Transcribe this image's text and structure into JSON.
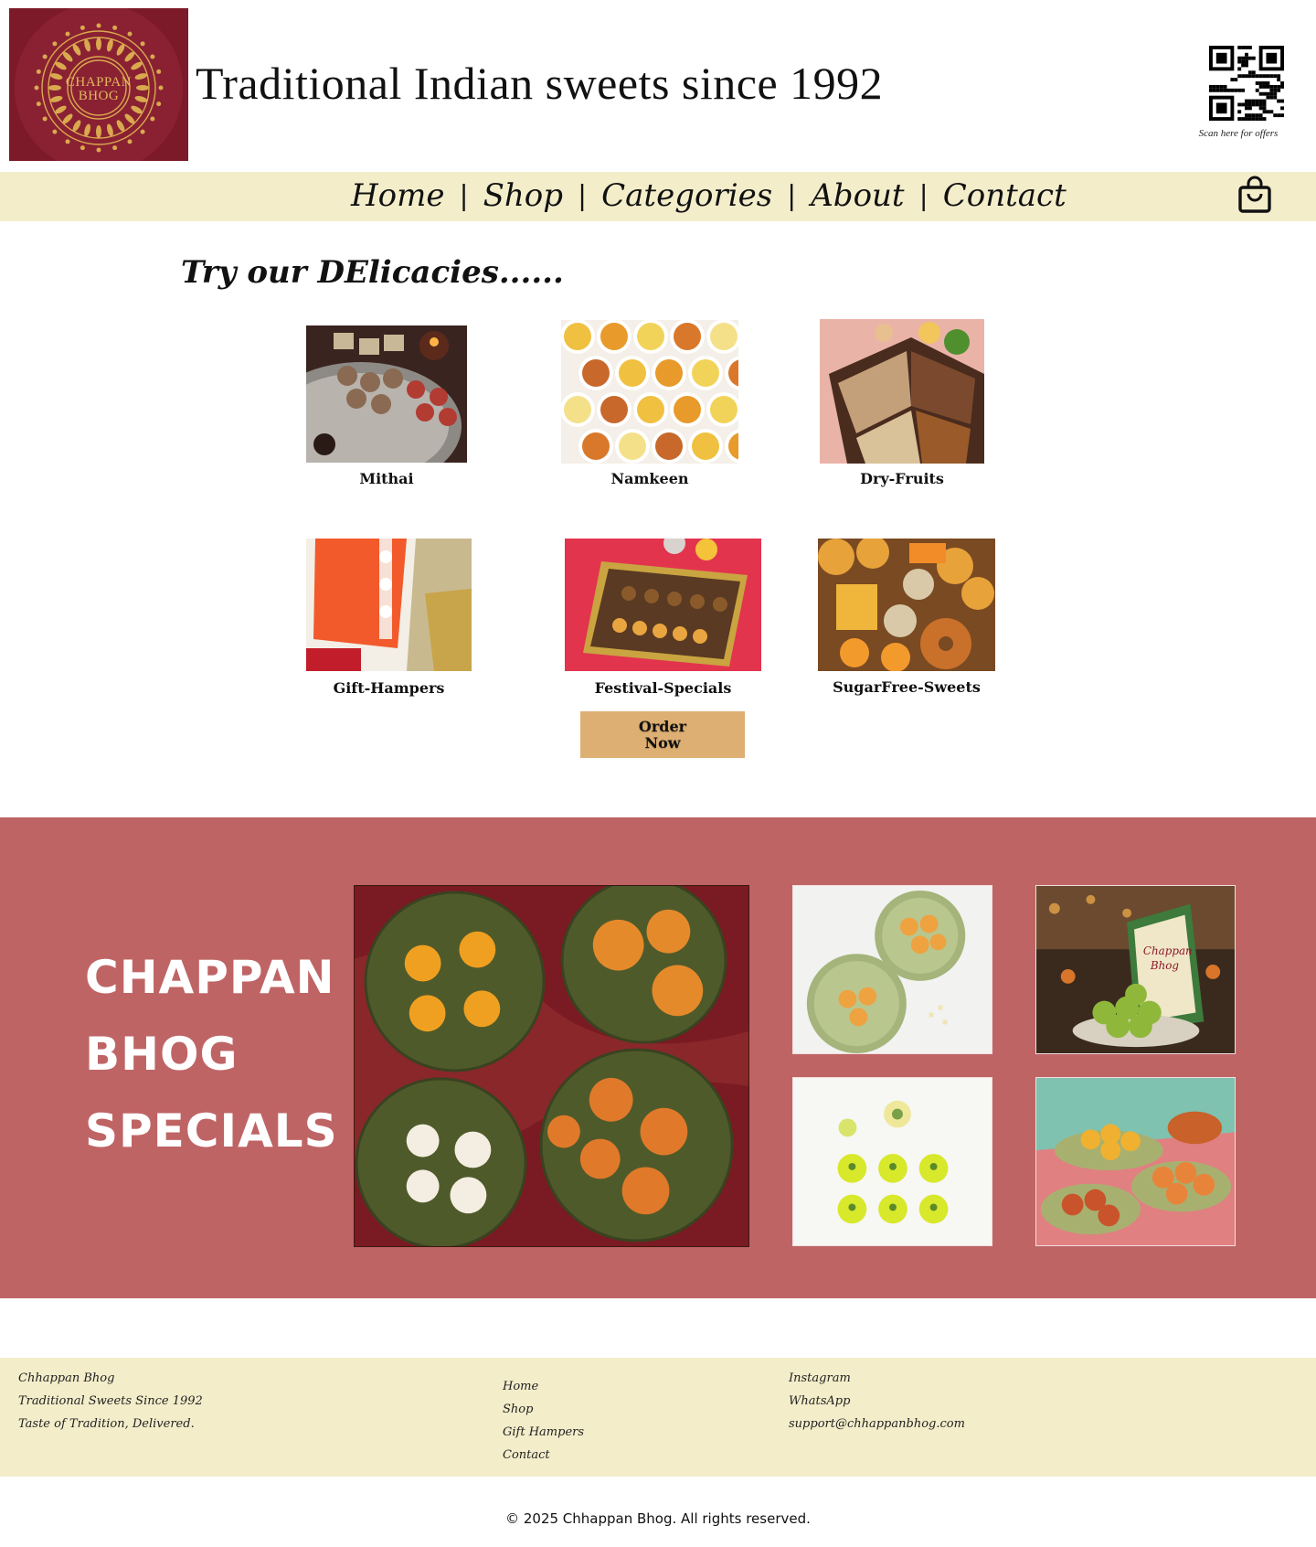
{
  "header": {
    "logo_lines": [
      "CHAPPAN",
      "BHOG"
    ],
    "tagline": "Traditional Indian sweets since 1992",
    "qr_caption": "Scan here for offers"
  },
  "nav": {
    "items": [
      {
        "label": "Home"
      },
      {
        "label": "Shop"
      },
      {
        "label": "Categories"
      },
      {
        "label": "About"
      },
      {
        "label": "Contact"
      }
    ],
    "separator": "|",
    "cart_icon": "shopping-bag-icon"
  },
  "delicacies": {
    "title": "Try our DElicacies......",
    "categories": [
      {
        "label": "Mithai"
      },
      {
        "label": "Namkeen"
      },
      {
        "label": "Dry-Fruits"
      },
      {
        "label": "Gift-Hampers"
      },
      {
        "label": "Festival-Specials"
      },
      {
        "label": "SugarFree-Sweets"
      }
    ],
    "order_button": [
      "Order",
      "Now"
    ]
  },
  "specials": {
    "title_lines": [
      "CHAPPAN",
      "BHOG",
      "SPECIALS"
    ],
    "image_box_lines": [
      "Chappan",
      "Bhog"
    ]
  },
  "footer": {
    "brand": [
      "Chhappan Bhog",
      "Traditional Sweets Since 1992",
      "Taste of Tradition, Delivered."
    ],
    "links": [
      "Home",
      "Shop",
      "Gift Hampers",
      "Contact"
    ],
    "social": [
      "Instagram",
      "WhatsApp",
      "support@chhappanbhog.com"
    ],
    "copyright": "© 2025 Chhappan Bhog. All rights reserved."
  },
  "colors": {
    "logo_bg": "#7d1a2a",
    "logo_gold": "#e3b85e",
    "nav_bg": "#f3edca",
    "order_button": "#deaf72",
    "specials_bg": "#bf6465",
    "footer_bg": "#f3edca"
  }
}
